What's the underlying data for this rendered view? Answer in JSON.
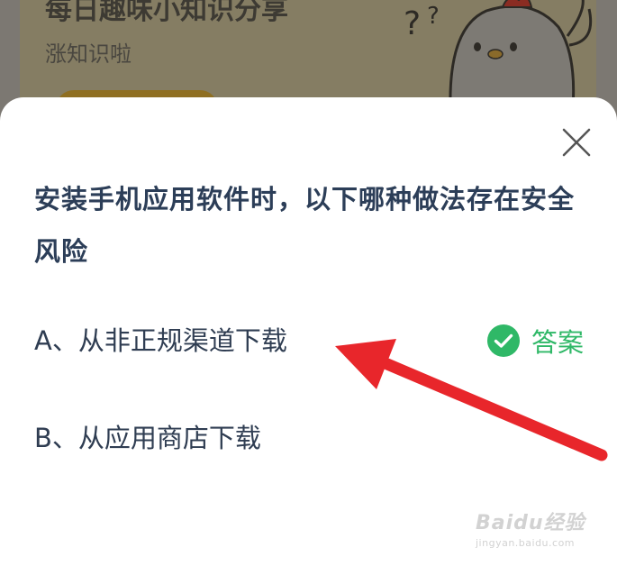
{
  "background": {
    "title": "每日趣味小知识分享",
    "subtitle": "涨知识啦"
  },
  "modal": {
    "question": "安装手机应用软件时，以下哪种做法存在安全风险",
    "options": [
      {
        "label": "A、从非正规渠道下载",
        "is_answer": true
      },
      {
        "label": "B、从应用商店下载",
        "is_answer": false
      }
    ],
    "answer_label": "答案",
    "close_icon": "close-icon",
    "check_icon": "check-circle-icon"
  },
  "watermark": {
    "logo": "Baidu经验",
    "url": "jingyan.baidu.com"
  },
  "colors": {
    "question_text": "#2c3e58",
    "answer_green": "#2fb867",
    "arrow_red": "#e8262b",
    "overlay": "#7c7872"
  }
}
